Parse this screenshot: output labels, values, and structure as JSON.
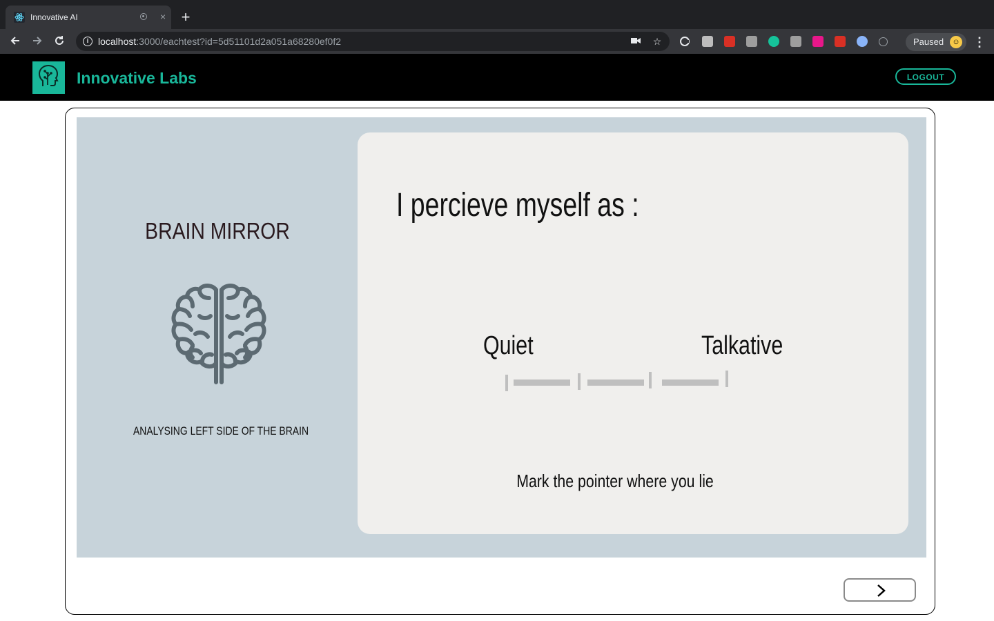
{
  "browser": {
    "tab_title": "Innovative AI",
    "tab_close": "×",
    "new_tab": "+",
    "url_host": "localhost",
    "url_path": ":3000/eachtest?id=5d51101d2a051a68280ef0f2",
    "profile_status": "Paused",
    "extensions": [
      {
        "name": "extension-1b-icon",
        "color": "#bdbdbd"
      },
      {
        "name": "extension-chart-icon",
        "color": "#d93025"
      },
      {
        "name": "extension-es-icon",
        "color": "#9e9e9e"
      },
      {
        "name": "grammarly-icon",
        "color": "#15c39a"
      },
      {
        "name": "extension-lock-icon",
        "color": "#9e9e9e"
      },
      {
        "name": "extension-w-icon",
        "color": "#e8178a"
      },
      {
        "name": "extension-puzzle-icon",
        "color": "#d93025"
      },
      {
        "name": "extension-drop-icon",
        "color": "#8ab4f8"
      },
      {
        "name": "extension-clock-icon",
        "color": "#9aa0a6"
      }
    ]
  },
  "header": {
    "brand": "Innovative Labs",
    "logout_label": "LOGOUT",
    "accent": "#19b79a"
  },
  "sidebar": {
    "title": "BRAIN MIRROR",
    "subtitle": "ANALYSING LEFT SIDE OF THE BRAIN",
    "icon": "brain-icon"
  },
  "question": {
    "prompt": "I percieve myself as :",
    "left_label": "Quiet",
    "right_label": "Talkative",
    "hint": "Mark  the pointer where you lie",
    "scale_points": 4
  },
  "navigation": {
    "next_icon": "chevron-right-icon"
  }
}
